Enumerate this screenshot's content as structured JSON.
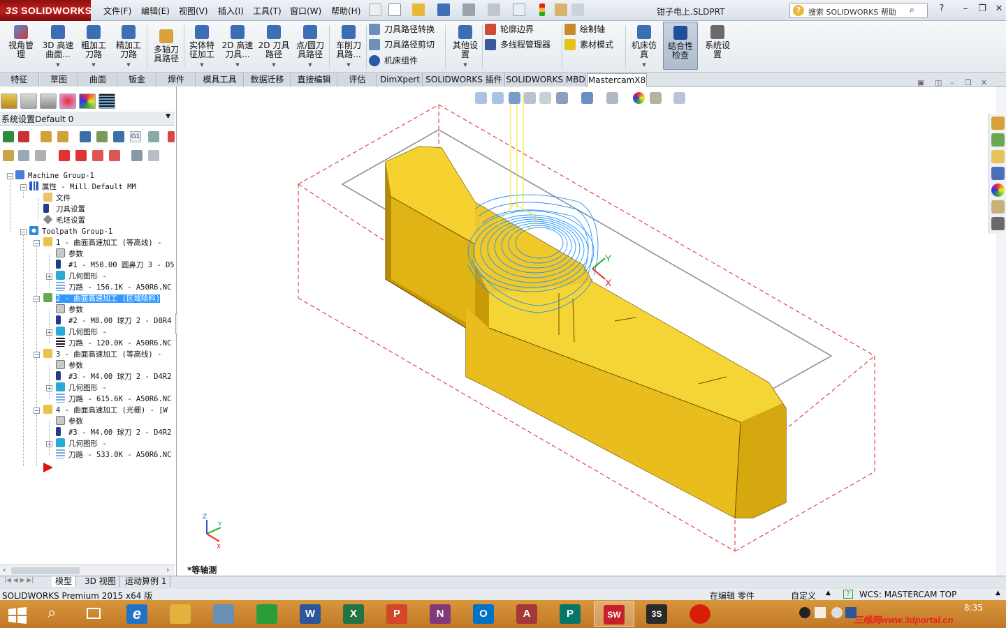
{
  "app": {
    "logo_text": "SOLIDWORKS",
    "document_title": "钳子电上.SLDPRT",
    "help_search_placeholder": "搜索 SOLIDWORKS 帮助"
  },
  "menu": [
    {
      "label": "文件(F)"
    },
    {
      "label": "编辑(E)"
    },
    {
      "label": "视图(V)"
    },
    {
      "label": "插入(I)"
    },
    {
      "label": "工具(T)"
    },
    {
      "label": "窗口(W)"
    },
    {
      "label": "帮助(H)"
    }
  ],
  "ribbon": {
    "big_buttons": [
      {
        "label": "视角管\n理",
        "icon": "view-manager-icon"
      },
      {
        "label": "3D 高速\n曲面...",
        "icon": "3d-highspeed-icon"
      },
      {
        "label": "粗加工\n刀路",
        "icon": "roughing-icon"
      },
      {
        "label": "精加工\n刀路",
        "icon": "finishing-icon"
      },
      {
        "label": "多轴刀\n具路径",
        "icon": "multiaxis-icon"
      },
      {
        "label": "实体特\n征加工",
        "icon": "solid-feature-icon"
      },
      {
        "label": "2D 高速\n刀具...",
        "icon": "2d-highspeed-icon"
      },
      {
        "label": "2D 刀具\n路径",
        "icon": "2d-toolpath-icon"
      },
      {
        "label": "点/圆刀\n具路径",
        "icon": "point-circle-icon"
      },
      {
        "label": "车削刀\n具路...",
        "icon": "lathe-icon"
      },
      {
        "label": "其他设\n置",
        "icon": "other-settings-icon"
      },
      {
        "label": "机床仿\n真",
        "icon": "machine-sim-icon"
      },
      {
        "label": "结合性\n检查",
        "icon": "associativity-icon"
      },
      {
        "label": "系统设\n置",
        "icon": "system-settings-icon"
      }
    ],
    "small_buttons": [
      {
        "label": "刀具路径转换",
        "icon": "toolpath-transform-icon"
      },
      {
        "label": "刀具路径剪切",
        "icon": "toolpath-trim-icon"
      },
      {
        "label": "机床组件",
        "icon": "machine-component-icon"
      },
      {
        "label": "轮廓边界",
        "icon": "contour-boundary-icon"
      },
      {
        "label": "多线程管理器",
        "icon": "multithread-icon"
      },
      {
        "label": "绘制轴",
        "icon": "draw-axis-icon"
      },
      {
        "label": "素材模式",
        "icon": "stock-mode-icon"
      }
    ]
  },
  "tabs": [
    {
      "label": "特征"
    },
    {
      "label": "草图"
    },
    {
      "label": "曲面"
    },
    {
      "label": "钣金"
    },
    {
      "label": "焊件"
    },
    {
      "label": "模具工具"
    },
    {
      "label": "数据迁移"
    },
    {
      "label": "直接编辑"
    },
    {
      "label": "评估"
    },
    {
      "label": "DimXpert"
    },
    {
      "label": "SOLIDWORKS 插件"
    },
    {
      "label": "SOLIDWORKS MBD"
    },
    {
      "label": "MastercamX8"
    }
  ],
  "left_panel": {
    "config_label": "系统设置Default 0",
    "tree": [
      {
        "label": "Machine Group-1",
        "icon": "machine-group-icon"
      },
      {
        "label": "属性 - Mill Default MM",
        "icon": "properties-icon"
      },
      {
        "label": "文件",
        "icon": "folder-icon"
      },
      {
        "label": "刀具设置",
        "icon": "tool-icon"
      },
      {
        "label": "毛坯设置",
        "icon": "stock-icon"
      },
      {
        "label": "Toolpath Group-1",
        "icon": "toolpath-group-icon"
      },
      {
        "label": "1 - 曲面高速加工 (等高线) -",
        "icon": "operation-folder-icon"
      },
      {
        "label": "参数",
        "icon": "parameters-icon"
      },
      {
        "label": "#1 - M50.00 圆鼻刀 3 - D5",
        "icon": "tool-icon"
      },
      {
        "label": "几何图形 -",
        "icon": "geometry-icon"
      },
      {
        "label": "刀路 - 156.1K - A50R6.NC",
        "icon": "toolpath-icon"
      },
      {
        "label": "2 - 曲面高速加工 (区域除料)",
        "icon": "operation-folder-icon"
      },
      {
        "label": "参数",
        "icon": "parameters-icon"
      },
      {
        "label": "#2 - M8.00 球刀 2 - D8R4",
        "icon": "tool-icon"
      },
      {
        "label": "几何图形 -",
        "icon": "geometry-icon"
      },
      {
        "label": "刀路 - 120.0K - A50R6.NC",
        "icon": "toolpath-icon"
      },
      {
        "label": "3 - 曲面高速加工 (等高线) -",
        "icon": "operation-folder-icon"
      },
      {
        "label": "参数",
        "icon": "parameters-icon"
      },
      {
        "label": "#3 - M4.00 球刀 2 - D4R2",
        "icon": "tool-icon"
      },
      {
        "label": "几何图形 -",
        "icon": "geometry-icon"
      },
      {
        "label": "刀路 - 615.6K - A50R6.NC",
        "icon": "toolpath-icon"
      },
      {
        "label": "4 - 曲面高速加工 (光栅) - [W",
        "icon": "operation-folder-icon"
      },
      {
        "label": "参数",
        "icon": "parameters-icon"
      },
      {
        "label": "#3 - M4.00 球刀 2 - D4R2",
        "icon": "tool-icon"
      },
      {
        "label": "几何图形 -",
        "icon": "geometry-icon"
      },
      {
        "label": "刀路 - 533.0K - A50R6.NC",
        "icon": "toolpath-icon"
      }
    ]
  },
  "viewport": {
    "view_label": "*等轴测",
    "axis_labels": {
      "x": "X",
      "y": "Y",
      "z": "Z"
    }
  },
  "bottom_tabs": [
    {
      "label": "模型"
    },
    {
      "label": "3D 视图"
    },
    {
      "label": "运动算例 1"
    }
  ],
  "status": {
    "product": "SOLIDWORKS Premium 2015 x64 版",
    "editing": "在编辑 零件",
    "custom": "自定义",
    "wcs": "WCS: MASTERCAM TOP"
  },
  "taskbar": {
    "clock_time": "8:35",
    "watermark": "三维网www.3dportal.cn",
    "apps": [
      {
        "name": "ie-icon",
        "letter": "e",
        "color": "#1e73c8"
      },
      {
        "name": "file-explorer-icon",
        "letter": "",
        "color": "#e3b23c"
      },
      {
        "name": "calculator-icon",
        "letter": "",
        "color": "#6a8fb5"
      },
      {
        "name": "store-icon",
        "letter": "",
        "color": "#2a9d3a"
      },
      {
        "name": "word-icon",
        "letter": "W",
        "color": "#2b579a"
      },
      {
        "name": "excel-icon",
        "letter": "X",
        "color": "#217346"
      },
      {
        "name": "powerpoint-icon",
        "letter": "P",
        "color": "#d24726"
      },
      {
        "name": "onenote-icon",
        "letter": "N",
        "color": "#80397b"
      },
      {
        "name": "outlook-icon",
        "letter": "O",
        "color": "#0072c6"
      },
      {
        "name": "access-icon",
        "letter": "A",
        "color": "#a4373a"
      },
      {
        "name": "publisher-icon",
        "letter": "P",
        "color": "#077568"
      },
      {
        "name": "solidworks-2015-icon",
        "letter": "SW",
        "color": "#c8202a"
      },
      {
        "name": "3ds-icon",
        "letter": "3S",
        "color": "#2a2a2a"
      },
      {
        "name": "netease-music-icon",
        "letter": "",
        "color": "#d81e06"
      }
    ]
  },
  "colors": {
    "part_yellow": "#f2c417",
    "toolpath_blue": "#1e90ff",
    "bbox_red": "#e02020",
    "selection_blue": "#3399ff",
    "taskbar_orange": "#c9822f"
  }
}
